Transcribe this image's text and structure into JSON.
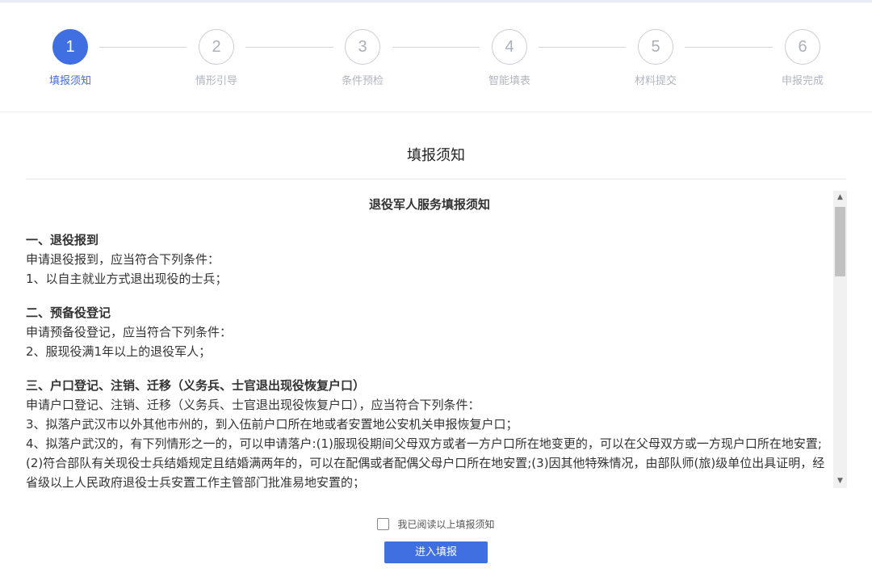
{
  "stepper": {
    "steps": [
      {
        "number": "1",
        "label": "填报须知"
      },
      {
        "number": "2",
        "label": "情形引导"
      },
      {
        "number": "3",
        "label": "条件预检"
      },
      {
        "number": "4",
        "label": "智能填表"
      },
      {
        "number": "5",
        "label": "材料提交"
      },
      {
        "number": "6",
        "label": "申报完成"
      }
    ],
    "active_step": 1
  },
  "page_title": "填报须知",
  "notice": {
    "heading": "退役军人服务填报须知",
    "sections": [
      {
        "title": "一、退役报到",
        "lines": [
          "申请退役报到，应当符合下列条件：",
          "1、以自主就业方式退出现役的士兵；"
        ]
      },
      {
        "title": "二、预备役登记",
        "lines": [
          "申请预备役登记，应当符合下列条件：",
          "2、服现役满1年以上的退役军人；"
        ]
      },
      {
        "title": "三、户口登记、注销、迁移（义务兵、士官退出现役恢复户口）",
        "lines": [
          "申请户口登记、注销、迁移（义务兵、士官退出现役恢复户口），应当符合下列条件：",
          "3、拟落户武汉市以外其他市州的，到入伍前户口所在地或者安置地公安机关申报恢复户口；",
          "4、拟落户武汉的，有下列情形之一的，可以申请落户:(1)服现役期间父母双方或者一方户口所在地变更的，可以在父母双方或一方现户口所在地安置;(2)符合部队有关现役士兵结婚规定且结婚满两年的，可以在配偶或者配偶父母户口所在地安置;(3)因其他特殊情况，由部队师(旅)级单位出具证明，经省级以上人民政府退役士兵安置工作主管部门批准易地安置的；"
        ]
      }
    ]
  },
  "agree_label": "我已阅读以上填报须知",
  "submit_label": "进入填报",
  "colors": {
    "accent": "#3f6fe0",
    "inactive": "#b0b5bf"
  }
}
